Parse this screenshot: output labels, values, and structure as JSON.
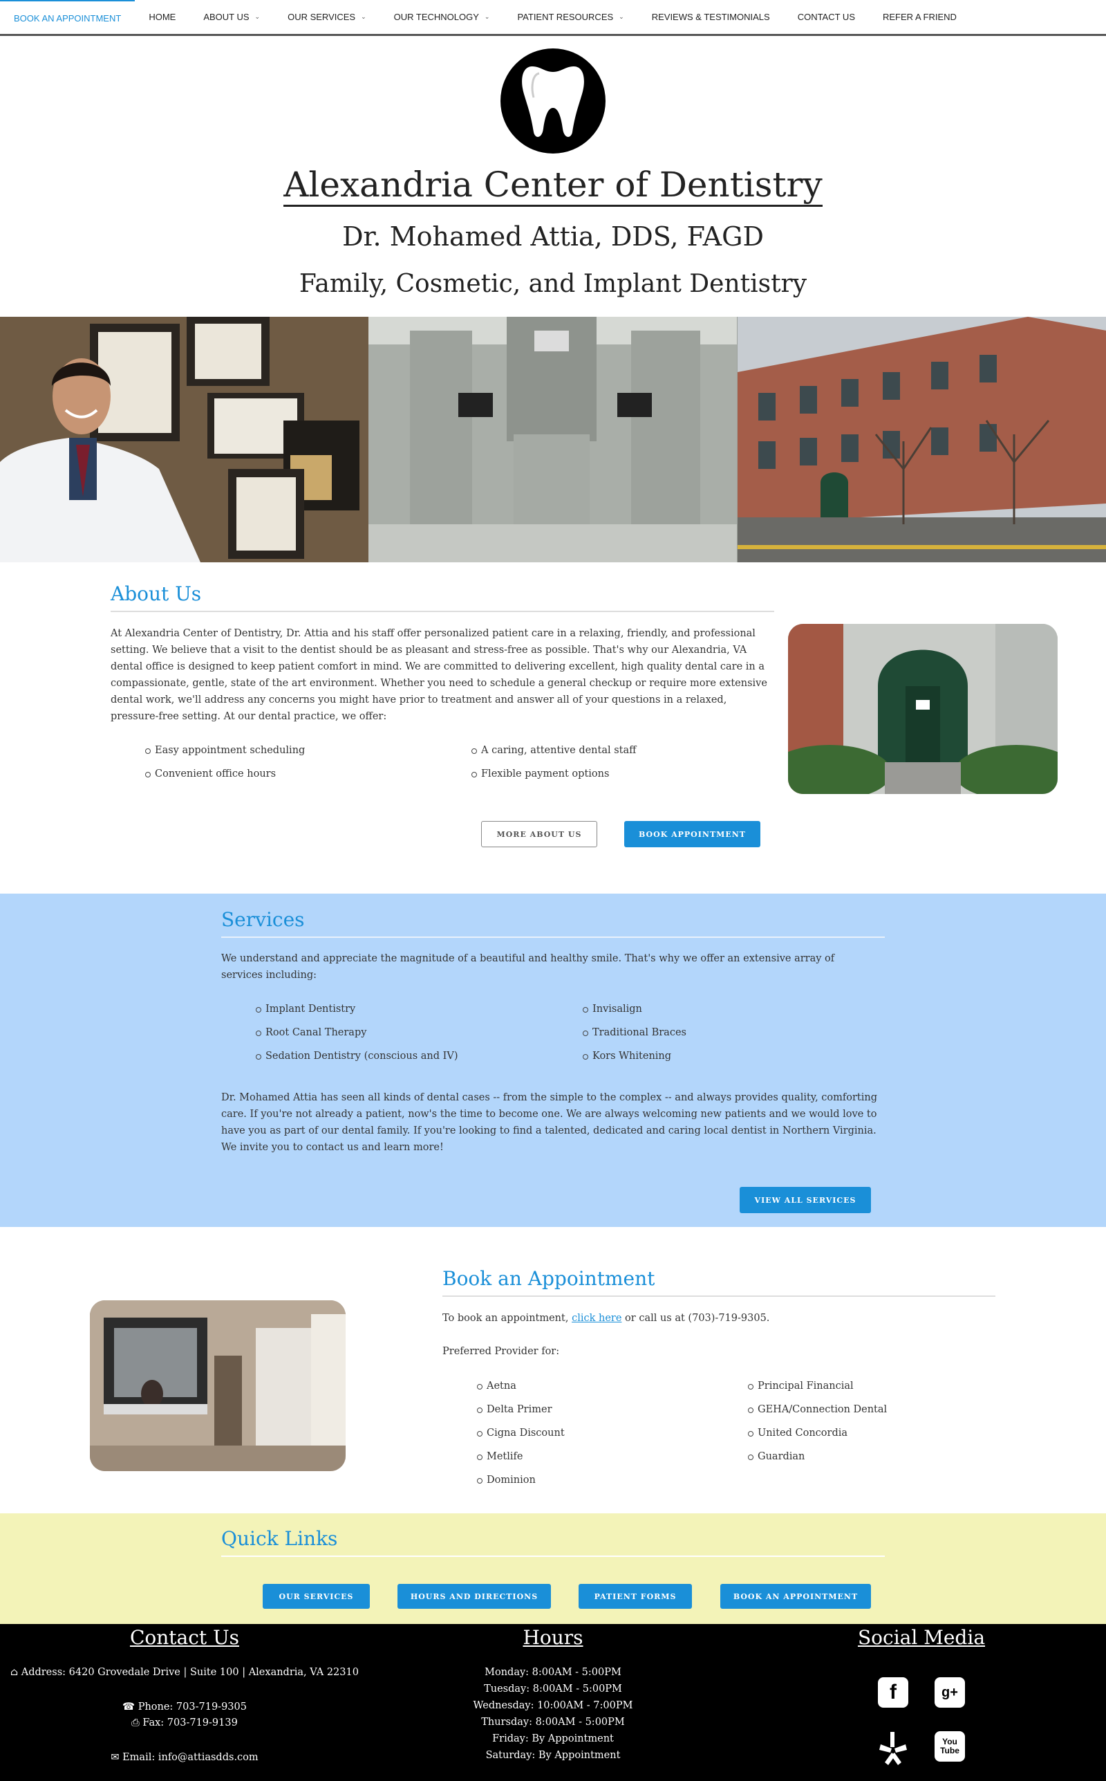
{
  "nav": {
    "items": [
      {
        "label": "BOOK AN APPOINTMENT",
        "dropdown": false
      },
      {
        "label": "HOME",
        "dropdown": false
      },
      {
        "label": "ABOUT US",
        "dropdown": true
      },
      {
        "label": "OUR SERVICES",
        "dropdown": true
      },
      {
        "label": "OUR TECHNOLOGY",
        "dropdown": true
      },
      {
        "label": "PATIENT RESOURCES",
        "dropdown": true
      },
      {
        "label": "REVIEWS & TESTIMONIALS",
        "dropdown": false
      },
      {
        "label": "CONTACT US",
        "dropdown": false
      },
      {
        "label": "REFER A FRIEND",
        "dropdown": false
      }
    ]
  },
  "header": {
    "practice_name": "Alexandria Center of Dentistry",
    "doctor": "Dr. Mohamed Attia, DDS, FAGD",
    "tagline": "Family, Cosmetic, and Implant Dentistry"
  },
  "about": {
    "heading": "About Us",
    "text": "At Alexandria Center of Dentistry, Dr. Attia and his staff offer personalized patient care in a relaxing, friendly, and professional setting. We believe that a visit to the dentist should be as pleasant and stress-free as possible. That's why our Alexandria, VA dental office is designed to keep patient comfort in mind. We are committed to delivering excellent, high quality dental care in a compassionate, gentle, state of the art environment. Whether you need to schedule a general checkup or require more extensive dental work, we'll address any concerns you might have prior to treatment and answer all of your questions in a relaxed, pressure-free setting. At our dental practice, we offer:",
    "list_left": [
      "Easy appointment scheduling",
      "Convenient office hours"
    ],
    "list_right": [
      "A caring, attentive dental staff",
      "Flexible payment options"
    ],
    "more_button": "MORE ABOUT US",
    "book_button": "BOOK APPOINTMENT"
  },
  "services": {
    "heading": "Services",
    "intro": "We understand and appreciate the magnitude of a beautiful and healthy smile. That's why we offer an extensive array of services including:",
    "list_left": [
      "Implant Dentistry",
      "Root Canal Therapy",
      "Sedation Dentistry (conscious and IV)"
    ],
    "list_right": [
      "Invisalign",
      "Traditional Braces",
      "Kors Whitening"
    ],
    "text": "Dr. Mohamed Attia has seen all kinds of dental cases -- from the simple to the complex -- and always provides quality, comforting care. If you're not already a patient, now's the time to become one. We are always welcoming new patients and we would love to have you as part of our dental family. If you're looking to find a talented, dedicated and caring local dentist in Northern Virginia. We invite you to contact us and learn more!",
    "button": "VIEW ALL SERVICES"
  },
  "book": {
    "heading": "Book an Appointment",
    "text_before": "To book an appointment, ",
    "link": "click here",
    "text_after": " or call us at (703)-719-9305.",
    "providers_label": "Preferred Provider for:",
    "list_left": [
      "Aetna",
      "Delta Primer",
      "Cigna Discount",
      "Metlife",
      "Dominion"
    ],
    "list_right": [
      "Principal Financial",
      "GEHA/Connection Dental",
      "United Concordia",
      "Guardian"
    ]
  },
  "quick_links": {
    "heading": "Quick Links",
    "buttons": [
      "OUR SERVICES",
      "HOURS AND DIRECTIONS",
      "PATIENT FORMS",
      "BOOK AN APPOINTMENT"
    ]
  },
  "footer": {
    "contact_heading": "Contact Us",
    "address": "Address: 6420 Grovedale Drive | Suite 100 | Alexandria, VA 22310",
    "phone": "Phone: 703-719-9305",
    "fax": "Fax: 703-719-9139",
    "email": "Email: info@attiasdds.com",
    "hours_heading": "Hours",
    "hours": [
      "Monday: 8:00AM - 5:00PM",
      "Tuesday: 8:00AM - 5:00PM",
      "Wednesday: 10:00AM - 7:00PM",
      "Thursday: 8:00AM - 5:00PM",
      "Friday: By Appointment",
      "Saturday: By Appointment"
    ],
    "social_heading": "Social Media",
    "social_icons": [
      "facebook-icon",
      "google-plus-icon",
      "yelp-icon",
      "youtube-icon"
    ]
  },
  "colors": {
    "accent": "#1a8fd8",
    "services_bg": "#b3d6fb",
    "quick_links_bg": "#f3f3b8",
    "footer_bg": "#000000"
  }
}
